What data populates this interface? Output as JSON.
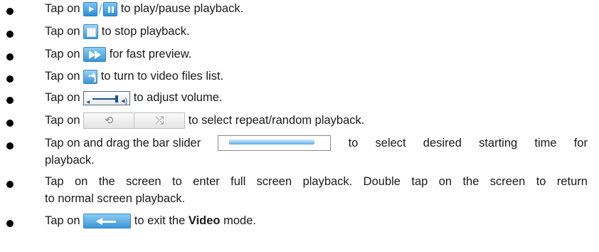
{
  "items": [
    {
      "pre": "Tap on",
      "post": "to play/pause playback.",
      "slash": "/"
    },
    {
      "pre": "Tap on",
      "post": "to stop playback."
    },
    {
      "pre": "Tap on",
      "post": "for fast preview."
    },
    {
      "pre": "Tap on",
      "post": "to turn to video files list."
    },
    {
      "pre": "Tap on",
      "post": "to adjust volume."
    },
    {
      "pre": "Tap on",
      "post": "to select repeat/random playback."
    },
    {
      "pre": "Tap on and drag the bar slider",
      "post_words": [
        "to",
        "select",
        "desired",
        "starting",
        "time",
        "for"
      ],
      "cont": "playback."
    },
    {
      "line1_words": [
        "Tap",
        "on",
        "the",
        "screen",
        "to",
        "enter",
        "full",
        "screen",
        "playback.",
        "Double",
        "tap",
        "on",
        "the",
        "screen",
        "to",
        "return"
      ],
      "cont": "to normal screen playback."
    },
    {
      "pre": "Tap on",
      "post": "to exit the",
      "bold": "Video",
      "post2": "mode."
    }
  ],
  "icons": {
    "play": "play-icon",
    "pause": "pause-icon",
    "stop": "stop-icon",
    "fast_forward": "fast-forward-icon",
    "return": "return-to-list-icon",
    "volume": "volume-slider-icon",
    "repeat": "repeat-icon",
    "random": "shuffle-icon",
    "progress": "progress-bar-slider-icon",
    "exit": "back-arrow-icon",
    "accent": "#3a96d7"
  }
}
